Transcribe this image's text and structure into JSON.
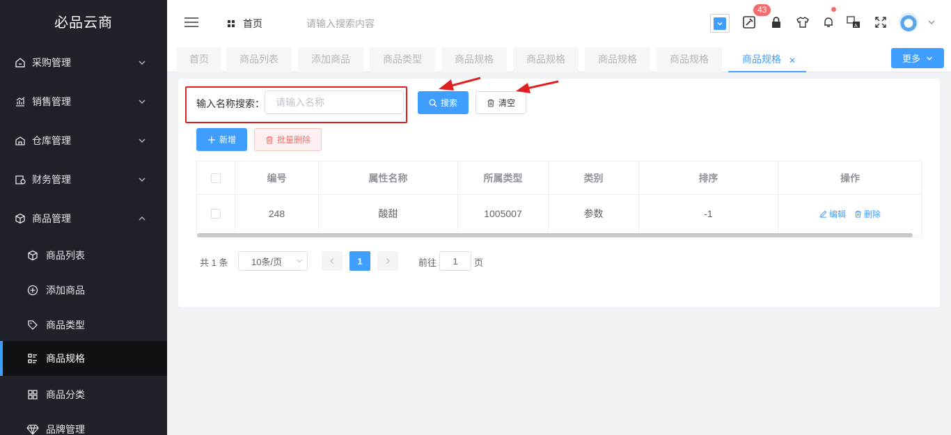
{
  "brand": "必品云商",
  "sidebar": {
    "menus": [
      {
        "label": "采购管理",
        "icon": "purchase-icon",
        "expanded": false
      },
      {
        "label": "销售管理",
        "icon": "sales-chart-icon",
        "expanded": false
      },
      {
        "label": "仓库管理",
        "icon": "warehouse-icon",
        "expanded": false
      },
      {
        "label": "财务管理",
        "icon": "finance-icon",
        "expanded": false
      },
      {
        "label": "商品管理",
        "icon": "product-box-icon",
        "expanded": true
      }
    ],
    "sub_items": [
      {
        "label": "商品列表",
        "icon": "cube-icon"
      },
      {
        "label": "添加商品",
        "icon": "plus-circle-icon"
      },
      {
        "label": "商品类型",
        "icon": "tag-icon"
      },
      {
        "label": "商品规格",
        "icon": "spec-list-icon",
        "active": true
      },
      {
        "label": "商品分类",
        "icon": "grid-icon"
      },
      {
        "label": "品牌管理",
        "icon": "diamond-icon"
      }
    ]
  },
  "header": {
    "home": "首页",
    "search_placeholder": "请输入搜索内容",
    "badge_count": "43",
    "icons": [
      "hamburger-icon",
      "dashboard-icon",
      "select-box-icon",
      "tools-icon",
      "lock-icon",
      "shirt-icon",
      "bell-icon",
      "translate-icon",
      "fullscreen-icon",
      "avatar",
      "chevron-down-icon"
    ]
  },
  "tabs": {
    "items": [
      "首页",
      "商品列表",
      "添加商品",
      "商品类型",
      "商品规格",
      "商品规格",
      "商品规格",
      "商品规格",
      "商品规格"
    ],
    "active_index": 8,
    "more": "更多",
    "ghost_text": "43"
  },
  "search": {
    "label": "输入名称搜索：",
    "placeholder": "请输入名称",
    "search_btn": "搜索",
    "clear_btn": "清空"
  },
  "actions": {
    "add": "新增",
    "batch_delete": "批量删除"
  },
  "table": {
    "headers": [
      "编号",
      "属性名称",
      "所属类型",
      "类别",
      "排序",
      "操作"
    ],
    "rows": [
      {
        "id": "248",
        "name": "酸甜",
        "type": "1005007",
        "category": "参数",
        "sort": "-1"
      }
    ],
    "edit": "编辑",
    "delete": "删除"
  },
  "pagination": {
    "total": "共 1 条",
    "page_size": "10条/页",
    "current": "1",
    "goto_label": "前往",
    "goto_value": "1",
    "unit": "页"
  },
  "colors": {
    "primary": "#409eff",
    "sidebar_bg": "#1f2229",
    "danger": "#f56c6c",
    "annotation": "#e02020"
  }
}
